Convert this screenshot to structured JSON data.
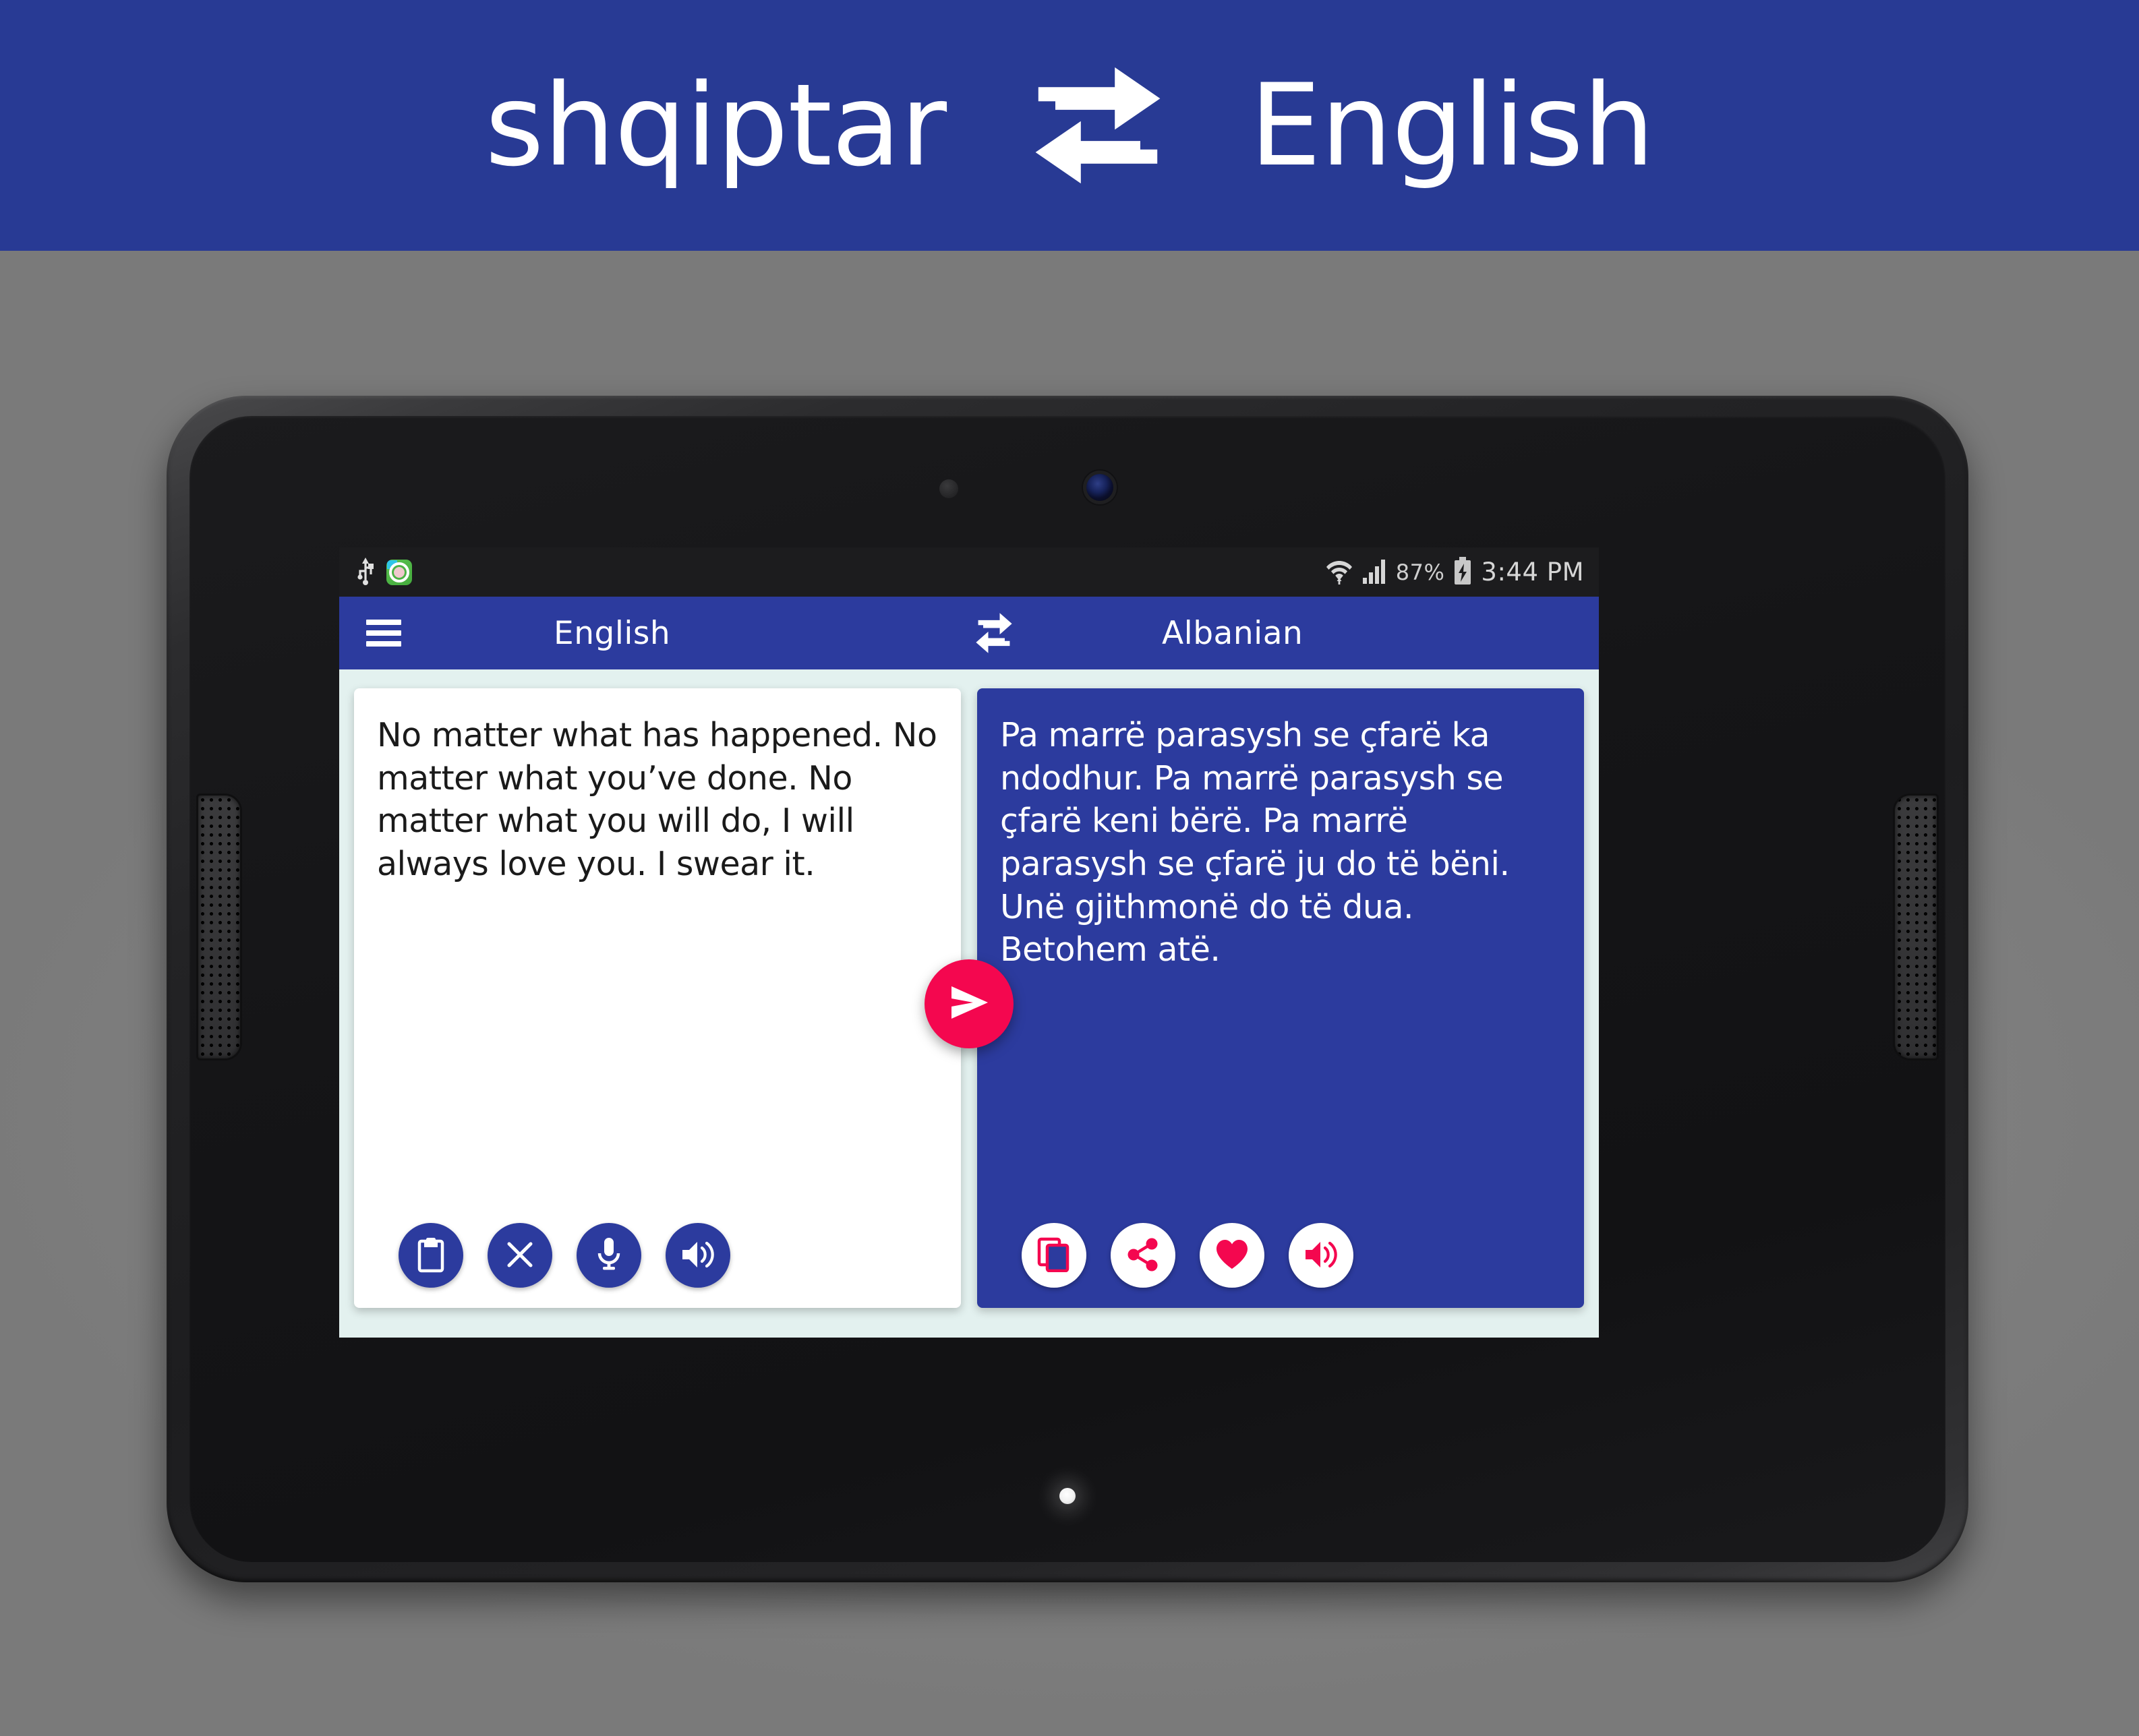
{
  "promo": {
    "source_language": "shqiptar",
    "target_language": "English",
    "swap_icon": "swap-arrows-icon",
    "background_color": "#283A94",
    "text_color": "#FFFFFF"
  },
  "device": {
    "type": "android-tablet",
    "body_color": "#1D1D1F",
    "speaker_left": "speaker-grille-left",
    "speaker_right": "speaker-grille-right",
    "front_camera": "front-camera",
    "proximity_sensor": "proximity-sensor",
    "home_led": "home-indicator-led"
  },
  "status_bar": {
    "usb_icon": "usb-icon",
    "app_icon": "app-notification-icon",
    "wifi_icon": "wifi-icon",
    "signal_icon": "cellular-signal-icon",
    "battery_percent": "87%",
    "battery_icon": "battery-charging-icon",
    "time": "3:44 PM",
    "background_color": "#1C1C1E"
  },
  "app_bar": {
    "menu_icon": "hamburger-menu-icon",
    "source_language": "English",
    "swap_icon": "swap-languages-icon",
    "target_language": "Albanian",
    "background_color": "#2C3B9E"
  },
  "source_panel": {
    "text": "No matter what has happened. No matter what you’ve done. No matter what you will do, I will always love you. I swear it.",
    "background_color": "#FFFFFF",
    "text_color": "#1A1A1A",
    "actions": [
      {
        "name": "paste-button",
        "icon": "clipboard-paste-icon",
        "label": "Paste"
      },
      {
        "name": "clear-button",
        "icon": "close-x-icon",
        "label": "Clear"
      },
      {
        "name": "voice-input-button",
        "icon": "microphone-icon",
        "label": "Speak"
      },
      {
        "name": "speak-source-button",
        "icon": "speaker-volume-icon",
        "label": "Listen"
      }
    ]
  },
  "target_panel": {
    "text": "Pa marrë parasysh se çfarë ka ndodhur. Pa marrë parasysh se çfarë keni bërë. Pa marrë parasysh se çfarë ju do të bëni. Unë gjithmonë do të dua. Betohem atë.",
    "background_color": "#2C3B9E",
    "text_color": "#FFFFFF",
    "actions": [
      {
        "name": "copy-button",
        "icon": "copy-icon",
        "label": "Copy"
      },
      {
        "name": "share-button",
        "icon": "share-icon",
        "label": "Share"
      },
      {
        "name": "favorite-button",
        "icon": "heart-icon",
        "label": "Favorite"
      },
      {
        "name": "speak-target-button",
        "icon": "speaker-volume-icon",
        "label": "Listen"
      }
    ]
  },
  "translate_button": {
    "name": "translate-send-button",
    "icon": "send-arrow-icon",
    "color": "#F4074F"
  },
  "colors": {
    "brand_blue": "#2C3B9E",
    "promo_blue": "#283A94",
    "accent_pink": "#F4074F",
    "page_grey": "#808080",
    "screen_background": "#E3F1EF"
  }
}
